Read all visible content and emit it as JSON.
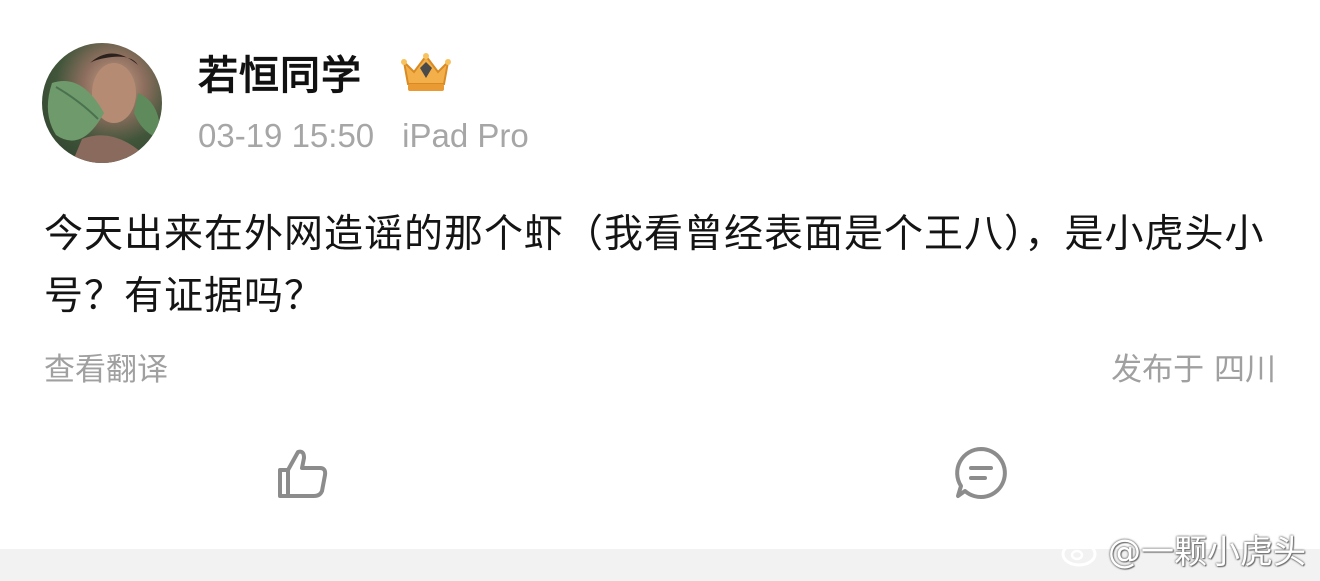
{
  "post": {
    "author": {
      "name": "若恒同学",
      "badge_icon": "crown-badge-icon"
    },
    "time": "03-19 15:50",
    "device": "iPad Pro",
    "content": "今天出来在外网造谣的那个虾（我看曾经表面是个王八），是小虎头小号？有证据吗？",
    "translate_label": "查看翻译",
    "location_label": "发布于 四川"
  },
  "actions": {
    "like_icon": "thumbs-up-icon",
    "comment_icon": "comment-icon"
  },
  "watermark": {
    "text": "@一颗小虎头",
    "logo": "weibo-logo-icon"
  },
  "colors": {
    "text": "#141414",
    "secondary": "#a6a6a6",
    "icon": "#8c8c8c",
    "badge_gold": "#f2a33a"
  }
}
